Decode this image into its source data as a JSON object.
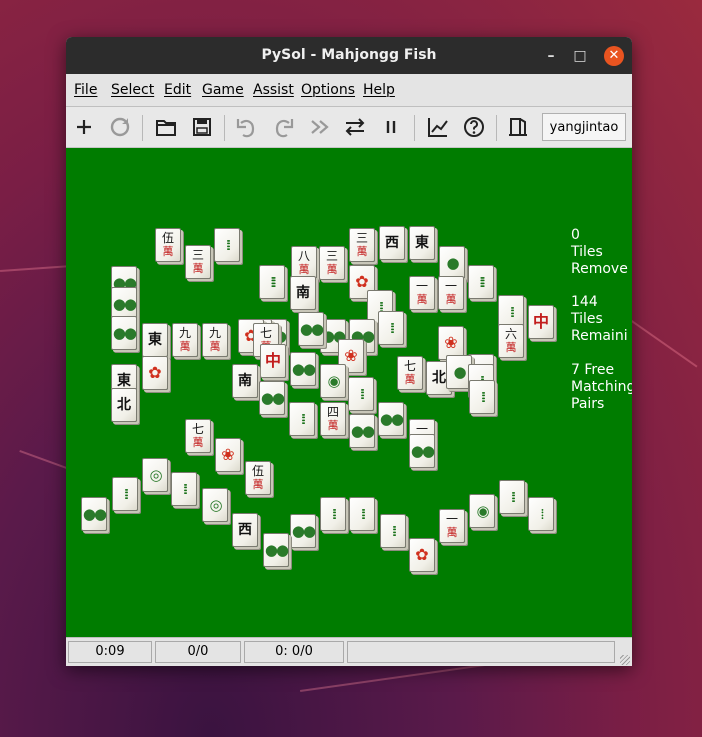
{
  "window": {
    "title": "PySol - Mahjongg Fish",
    "controls": {
      "minimize": "–",
      "maximize": "□",
      "close": "✕"
    }
  },
  "menu": [
    "File",
    "Select",
    "Edit",
    "Game",
    "Assist",
    "Options",
    "Help"
  ],
  "toolbar": {
    "buttons": [
      "new-game-icon",
      "restart-icon",
      "open-icon",
      "save-icon",
      "undo-icon",
      "redo-icon",
      "autodrop-icon",
      "shuffle-icon",
      "pause-icon",
      "statistics-icon",
      "rules-icon",
      "quit-icon"
    ],
    "player": "yangjintao"
  },
  "info": {
    "removed": "0\nTiles\nRemove",
    "remaining": "144\nTiles\nRemaini",
    "pairs": "7 Free\nMatching\nPairs"
  },
  "status": {
    "time": "0:09",
    "moves": "0/0",
    "score": "0: 0/0",
    "message": ""
  },
  "tiles": [
    {
      "t": "char",
      "g": "伍",
      "s": "萬"
    },
    {
      "t": "char",
      "g": "三",
      "s": "萬"
    },
    {
      "t": "bamboo",
      "g": "⁞⁞"
    },
    {
      "t": "char",
      "g": "八",
      "s": "萬"
    },
    {
      "t": "char",
      "g": "三",
      "s": "萬"
    },
    {
      "t": "char",
      "g": "三",
      "s": "萬"
    },
    {
      "t": "wind",
      "g": "西"
    },
    {
      "t": "wind",
      "g": "東"
    },
    {
      "t": "circle",
      "g": "●"
    },
    {
      "t": "bamboo",
      "g": "⁞⁞⁞"
    },
    {
      "t": "bamboo",
      "g": "⁞⁞⁞"
    },
    {
      "t": "circle",
      "g": "●●"
    },
    {
      "t": "wind",
      "g": "南"
    },
    {
      "t": "char",
      "g": "一",
      "s": "萬"
    },
    {
      "t": "char",
      "g": "一",
      "s": "萬"
    },
    {
      "t": "flower",
      "g": "✿"
    },
    {
      "t": "bamboo",
      "g": "⁞⁞"
    },
    {
      "t": "flower",
      "g": "❀"
    },
    {
      "t": "char",
      "g": "六",
      "s": "萬"
    },
    {
      "t": "dragon",
      "g": "中"
    },
    {
      "t": "circle",
      "g": "●●"
    },
    {
      "t": "circle",
      "g": "●●"
    },
    {
      "t": "wind",
      "g": "東"
    },
    {
      "t": "char",
      "g": "九",
      "s": "萬"
    },
    {
      "t": "char",
      "g": "九",
      "s": "萬"
    },
    {
      "t": "flower",
      "g": "✿"
    },
    {
      "t": "char",
      "g": "七",
      "s": "萬"
    },
    {
      "t": "circle",
      "g": "●●"
    },
    {
      "t": "circle",
      "g": "●●"
    },
    {
      "t": "circle",
      "g": "●●"
    },
    {
      "t": "circle",
      "g": "●●"
    },
    {
      "t": "circle",
      "g": "●●"
    },
    {
      "t": "flower",
      "g": "❀"
    },
    {
      "t": "bamboo",
      "g": "⁞⁞"
    },
    {
      "t": "bamboo",
      "g": "⁞⁞"
    },
    {
      "t": "wind",
      "g": "東"
    },
    {
      "t": "flower",
      "g": "✿"
    },
    {
      "t": "wind",
      "g": "南"
    },
    {
      "t": "dragon",
      "g": "中"
    },
    {
      "t": "circle",
      "g": "●●"
    },
    {
      "t": "circle",
      "g": "◉"
    },
    {
      "t": "char",
      "g": "七",
      "s": "萬"
    },
    {
      "t": "wind",
      "g": "北"
    },
    {
      "t": "circle",
      "g": "●"
    },
    {
      "t": "bamboo",
      "g": "⁞⁞"
    },
    {
      "t": "bamboo",
      "g": "⁞⁞"
    },
    {
      "t": "wind",
      "g": "北"
    },
    {
      "t": "circle",
      "g": "●●"
    },
    {
      "t": "bamboo",
      "g": "⁞⁞"
    },
    {
      "t": "char",
      "g": "四",
      "s": "萬"
    },
    {
      "t": "bamboo",
      "g": "⁞⁞"
    },
    {
      "t": "circle",
      "g": "●●"
    },
    {
      "t": "circle",
      "g": "●●"
    },
    {
      "t": "char",
      "g": "一",
      "s": "萬"
    },
    {
      "t": "circle",
      "g": "●●"
    },
    {
      "t": "bamboo",
      "g": "⁞⁞"
    },
    {
      "t": "char",
      "g": "七",
      "s": "萬"
    },
    {
      "t": "flower",
      "g": "❀"
    },
    {
      "t": "char",
      "g": "伍",
      "s": "萬"
    },
    {
      "t": "circle",
      "g": "●●"
    },
    {
      "t": "bamboo",
      "g": "⁞⁞"
    },
    {
      "t": "circle",
      "g": "◎"
    },
    {
      "t": "bamboo",
      "g": "⁞⁞"
    },
    {
      "t": "circle",
      "g": "◎"
    },
    {
      "t": "wind",
      "g": "西"
    },
    {
      "t": "circle",
      "g": "●●"
    },
    {
      "t": "circle",
      "g": "●●"
    },
    {
      "t": "bamboo",
      "g": "⁞⁞"
    },
    {
      "t": "bamboo",
      "g": "⁞⁞"
    },
    {
      "t": "bamboo",
      "g": "⁞⁞"
    },
    {
      "t": "flower",
      "g": "✿"
    },
    {
      "t": "char",
      "g": "一",
      "s": "萬"
    },
    {
      "t": "circle",
      "g": "◉"
    },
    {
      "t": "bamboo",
      "g": "⁞⁞"
    },
    {
      "t": "bamboo",
      "g": "⁞"
    }
  ]
}
